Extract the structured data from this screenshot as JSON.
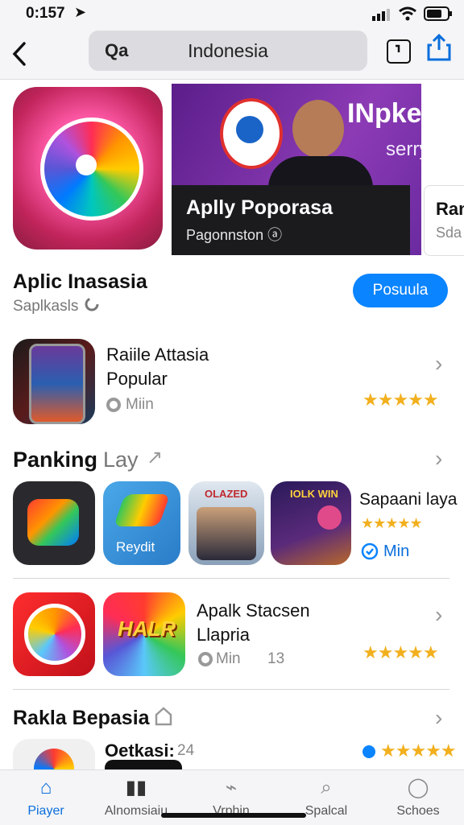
{
  "status_bar": {
    "time": "0:157",
    "arrow": "➤"
  },
  "header": {
    "search_icon": "Qa",
    "search_text": "Indonesia"
  },
  "banner": {
    "brand": "INpkey",
    "brand_sub": "serry",
    "title": "Aplly Poporasa",
    "subtitle": "Pagonnston ⓐ",
    "next_card_title": "Ran",
    "next_card_sub": "Sda"
  },
  "section1": {
    "title": "Aplic Inasasia",
    "subtitle": "Saplkasls",
    "button": "Posuula"
  },
  "item1": {
    "title_line1": "Raiile Attasia",
    "title_line2": "Popular",
    "meta": "Miin",
    "stars": "★★★★★"
  },
  "section2": {
    "title_bold": "Panking",
    "title_light": "Lay",
    "arrow": "↗"
  },
  "ranking": [
    {
      "label": ""
    },
    {
      "label": "Reydit"
    },
    {
      "label": "OLAZED"
    },
    {
      "label": "IOLK WIN"
    }
  ],
  "ranking_side": {
    "title": "Sapaani laya",
    "stars": "★★★★★",
    "meta": "Min"
  },
  "item2": {
    "title_line1": "Apalk Stacsen",
    "title_line2": "Llapria",
    "meta": "Min",
    "count": "13",
    "stars": "★★★★★",
    "game_label": "HALR"
  },
  "section3": {
    "title": "Rakla Bepasia",
    "row_title": "Oetkasi:",
    "row_count": "24",
    "stars": "★★★★★"
  },
  "tabs": [
    {
      "label": "Piayer",
      "icon": "⌂"
    },
    {
      "label": "Alnomsiaiu",
      "icon": "▮▮"
    },
    {
      "label": "Vrphin",
      "icon": "⌁"
    },
    {
      "label": "Spalcal",
      "icon": "⌕"
    },
    {
      "label": "Schoes",
      "icon": "◯"
    }
  ],
  "colors": {
    "accent": "#0a84ff",
    "star": "#f2b01e",
    "promo_bg": "#7a2fb0"
  }
}
